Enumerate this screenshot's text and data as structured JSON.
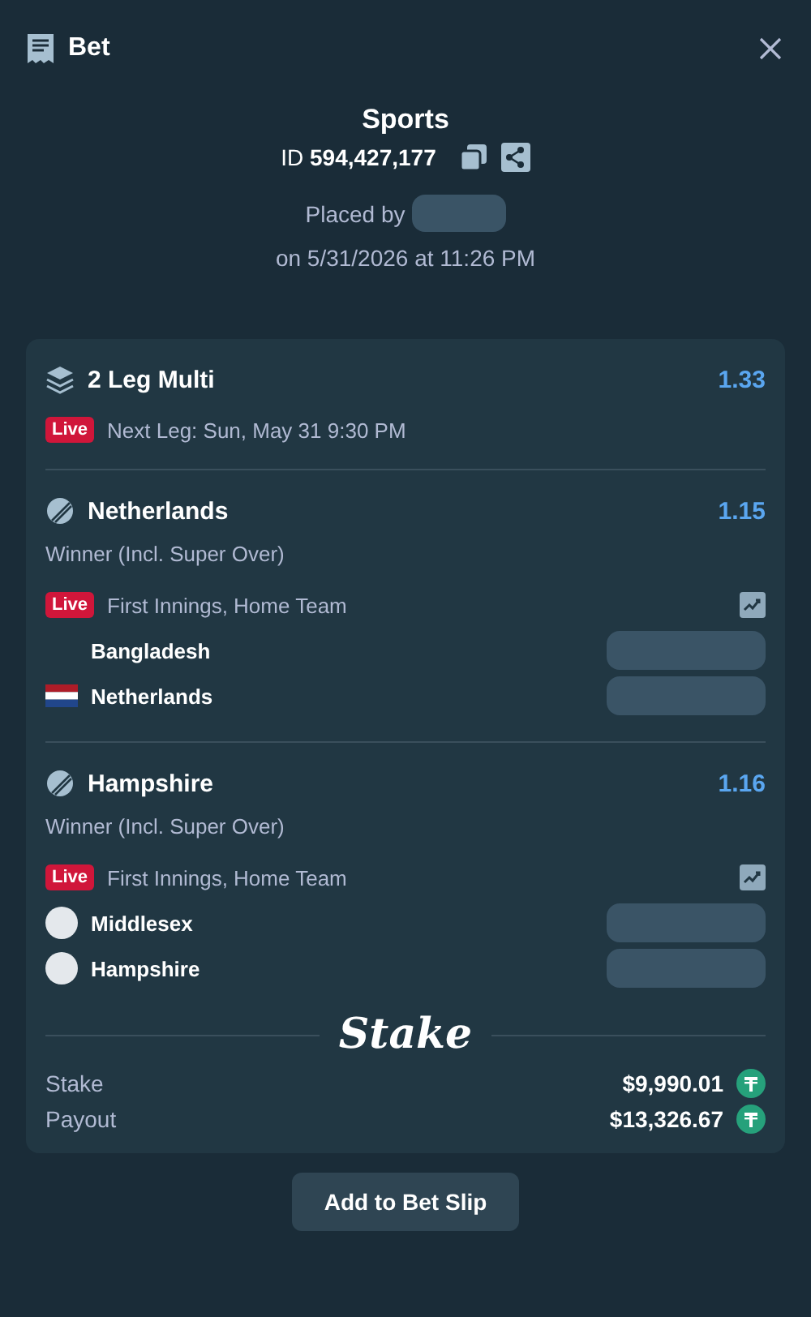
{
  "header": {
    "title": "Bet"
  },
  "summary": {
    "category": "Sports",
    "id_label": "ID",
    "id_value": "594,427,177",
    "placed_by": "Placed by",
    "placed_on": "on 5/31/2026 at 11:26 PM"
  },
  "multi": {
    "title": "2 Leg Multi",
    "odds": "1.33",
    "live": true,
    "live_label": "Live",
    "next_leg": "Next Leg: Sun, May 31 9:30 PM"
  },
  "legs": [
    {
      "title": "Netherlands",
      "odds": "1.15",
      "market": "Winner (Incl. Super Over)",
      "live": true,
      "live_label": "Live",
      "status": "First Innings, Home Team",
      "teams": [
        {
          "name": "Bangladesh",
          "kind": "none"
        },
        {
          "name": "Netherlands",
          "kind": "flag"
        }
      ]
    },
    {
      "title": "Hampshire",
      "odds": "1.16",
      "market": "Winner (Incl. Super Over)",
      "live": true,
      "live_label": "Live",
      "status": "First Innings, Home Team",
      "teams": [
        {
          "name": "Middlesex",
          "kind": "circle"
        },
        {
          "name": "Hampshire",
          "kind": "circle"
        }
      ]
    }
  ],
  "brand": "Stake",
  "totals": [
    {
      "label": "Stake",
      "value": "$9,990.01"
    },
    {
      "label": "Payout",
      "value": "$13,326.67"
    }
  ],
  "button": "Add to Bet Slip"
}
